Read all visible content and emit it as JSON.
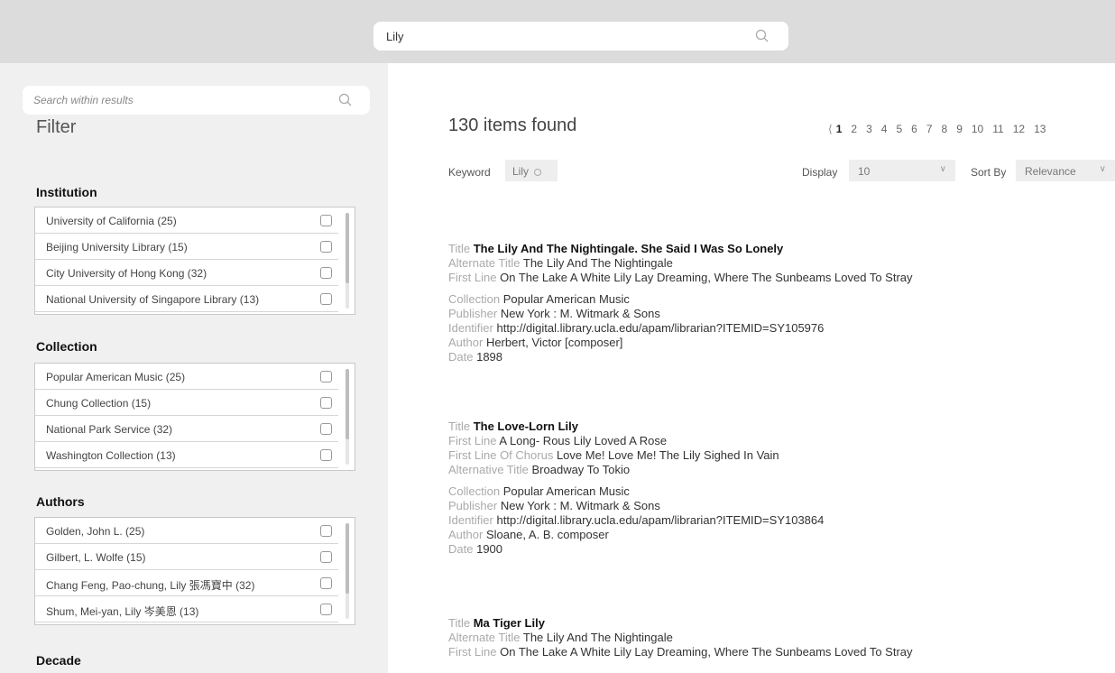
{
  "search": {
    "query": "Lily"
  },
  "sidebar": {
    "search_placeholder": "Search within results",
    "filter_title": "Filter",
    "groups": [
      {
        "title": "Institution",
        "items": [
          "University of California (25)",
          "Beijing University Library (15)",
          "City University of Hong Kong (32)",
          "National University of Singapore Library (13)"
        ]
      },
      {
        "title": "Collection",
        "items": [
          "Popular American Music (25)",
          "Chung Collection (15)",
          "National Park Service (32)",
          "Washington Collection (13)"
        ]
      },
      {
        "title": "Authors",
        "items": [
          "Golden, John L.  (25)",
          "Gilbert, L. Wolfe  (15)",
          "Chang Feng, Pao-chung, Lily 張馮寶中 (32)",
          "Shum, Mei-yan, Lily 岑美恩 (13)"
        ]
      },
      {
        "title": "Decade",
        "items": []
      }
    ]
  },
  "results_header": {
    "count": "130 items found",
    "pages": [
      "1",
      "2",
      "3",
      "4",
      "5",
      "6",
      "7",
      "8",
      "9",
      "10",
      "11",
      "12",
      "13"
    ],
    "current_page": "1",
    "keyword_label": "Keyword",
    "keyword_value": "Lily",
    "display_label": "Display",
    "display_value": "10",
    "sort_label": "Sort By",
    "sort_value": "Relevance"
  },
  "results": [
    {
      "fields_a": [
        {
          "k": "Title",
          "v": "The Lily And The Nightingale. She Said I Was So Lonely",
          "title": true
        },
        {
          "k": "Alternate Title",
          "v": "The Lily And The Nightingale"
        },
        {
          "k": "First Line",
          "v": "On The Lake A White Lily Lay Dreaming, Where The Sunbeams Loved To Stray"
        }
      ],
      "fields_b": [
        {
          "k": "Collection",
          "v": "Popular American Music"
        },
        {
          "k": "Publisher",
          "v": "New York : M. Witmark & Sons"
        },
        {
          "k": "Identifier",
          "v": "http://digital.library.ucla.edu/apam/librarian?ITEMID=SY105976"
        },
        {
          "k": "Author",
          "v": "Herbert, Victor [composer]"
        },
        {
          "k": "Date",
          "v": "1898"
        }
      ]
    },
    {
      "fields_a": [
        {
          "k": "Title",
          "v": "The Love-Lorn Lily",
          "title": true
        },
        {
          "k": "First Line",
          "v": "A Long- Rous Lily Loved A Rose"
        },
        {
          "k": "First Line Of Chorus",
          "v": "Love Me! Love Me! The Lily Sighed In Vain"
        },
        {
          "k": "Alternative Title",
          "v": "Broadway To Tokio"
        }
      ],
      "fields_b": [
        {
          "k": "Collection",
          "v": "Popular American Music"
        },
        {
          "k": "Publisher",
          "v": "New York : M. Witmark & Sons"
        },
        {
          "k": "Identifier",
          "v": "http://digital.library.ucla.edu/apam/librarian?ITEMID=SY103864"
        },
        {
          "k": "Author",
          "v": "Sloane, A. B. composer"
        },
        {
          "k": "Date",
          "v": "1900"
        }
      ]
    },
    {
      "fields_a": [
        {
          "k": "Title",
          "v": "Ma Tiger Lily",
          "title": true
        },
        {
          "k": "Alternate Title",
          "v": "The Lily And The Nightingale"
        },
        {
          "k": "First Line",
          "v": "On The Lake A White Lily Lay Dreaming, Where The Sunbeams Loved To Stray"
        }
      ],
      "fields_b": []
    }
  ]
}
